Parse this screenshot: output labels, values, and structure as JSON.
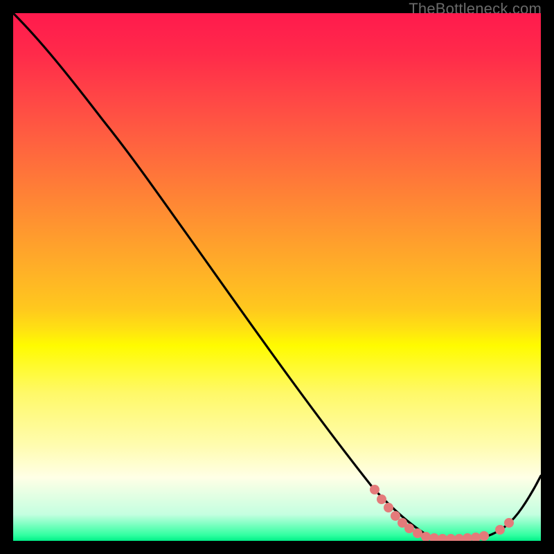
{
  "watermark": "TheBottleneck.com",
  "colors": {
    "gradient_top": "#ff1a4d",
    "gradient_mid": "#fffb00",
    "gradient_bottom": "#00ee87",
    "curve": "#000000",
    "markers": "#e47a7a",
    "frame": "#000000"
  },
  "chart_data": {
    "type": "line",
    "title": "",
    "xlabel": "",
    "ylabel": "",
    "xlim": [
      0,
      100
    ],
    "ylim": [
      0,
      100
    ],
    "background_gradient": {
      "direction": "vertical",
      "stops": [
        {
          "pos": 0.0,
          "color": "#ff1a4d"
        },
        {
          "pos": 0.32,
          "color": "#ff7a38"
        },
        {
          "pos": 0.56,
          "color": "#ffc81e"
        },
        {
          "pos": 0.63,
          "color": "#fffb00"
        },
        {
          "pos": 0.88,
          "color": "#ffffe6"
        },
        {
          "pos": 1.0,
          "color": "#00ee87"
        }
      ]
    },
    "series": [
      {
        "name": "bottleneck-curve",
        "color": "#000000",
        "x": [
          0,
          5,
          10,
          17,
          25,
          33,
          42,
          55,
          68,
          75,
          79,
          83,
          87,
          90,
          94,
          97,
          100
        ],
        "y": [
          100,
          95,
          88,
          80,
          68,
          58,
          45,
          26,
          10,
          3,
          1,
          0,
          0,
          1,
          3,
          8,
          12
        ]
      }
    ],
    "markers": {
      "name": "valley-dots",
      "color": "#e47a7a",
      "x": [
        68,
        70,
        71,
        72,
        74,
        75,
        77,
        78,
        80,
        81,
        83,
        85,
        86,
        88,
        89,
        92,
        94
      ],
      "y": [
        10,
        8,
        6,
        5,
        3,
        2,
        1,
        1,
        0,
        0,
        0,
        0,
        0,
        0,
        1,
        2,
        3
      ]
    }
  }
}
